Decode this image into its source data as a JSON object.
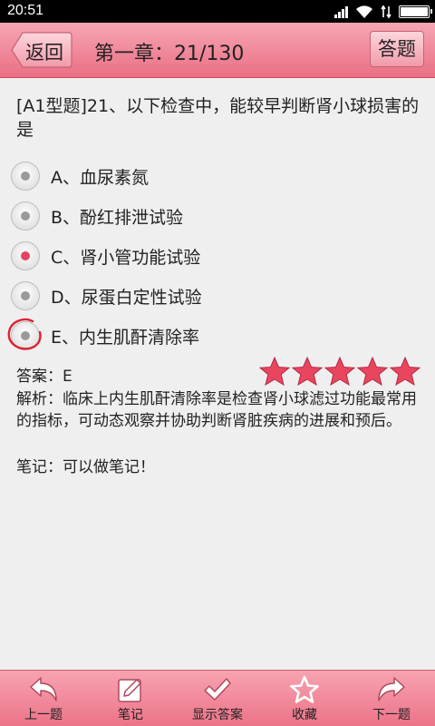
{
  "status_bar": {
    "time": "20:51"
  },
  "header": {
    "back_label": "返回",
    "chapter_progress": "第一章：21/130",
    "answer_label": "答题"
  },
  "question": {
    "text": "[A1型题]21、以下检查中，能较早判断肾小球损害的是"
  },
  "options": [
    {
      "label": "A、血尿素氮",
      "selected": false
    },
    {
      "label": "B、酚红排泄试验",
      "selected": false
    },
    {
      "label": "C、肾小管功能试验",
      "selected": true
    },
    {
      "label": "D、尿蛋白定性试验",
      "selected": false
    },
    {
      "label": "E、内生肌酐清除率",
      "selected": false,
      "marked_correct": true
    }
  ],
  "answer": {
    "text": "答案：E"
  },
  "rating": {
    "stars": 5,
    "max": 5,
    "color": "#e8455f"
  },
  "analysis": {
    "text": "解析：临床上内生肌酐清除率是检查肾小球滤过功能最常用的指标，可动态观察并协助判断肾脏疾病的进展和预后。"
  },
  "note": {
    "text": "笔记：可以做笔记！"
  },
  "bottom_nav": [
    {
      "label": "上一题",
      "icon": "undo-arrow-icon"
    },
    {
      "label": "笔记",
      "icon": "edit-note-icon"
    },
    {
      "label": "显示答案",
      "icon": "checkmark-icon"
    },
    {
      "label": "收藏",
      "icon": "star-outline-icon"
    },
    {
      "label": "下一题",
      "icon": "redo-arrow-icon"
    }
  ],
  "colors": {
    "accent": "#ec7388",
    "selected_radio": "#e34560"
  }
}
